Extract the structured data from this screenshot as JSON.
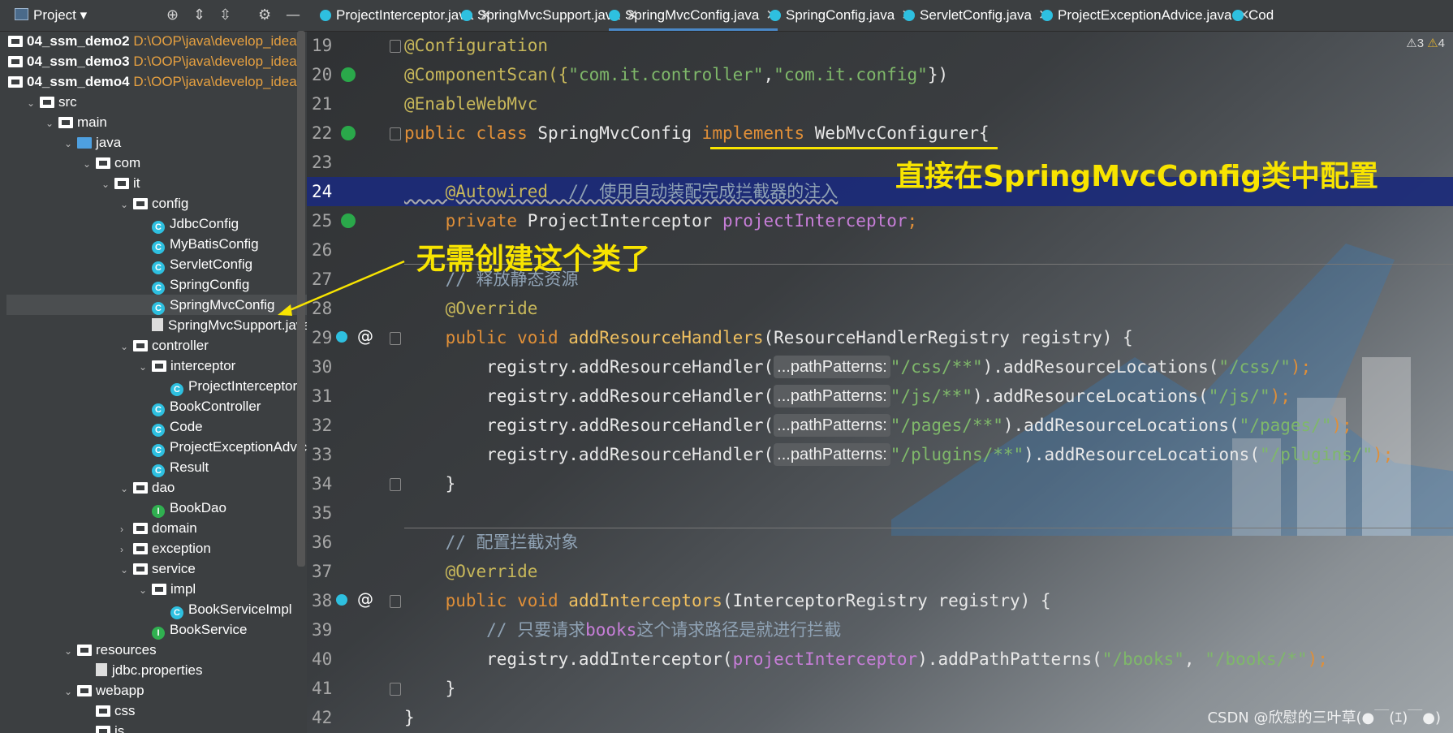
{
  "project_panel": {
    "title": "Project",
    "tree": [
      {
        "label": "04_ssm_demo2",
        "path": "D:\\OOP\\java\\develop_idea",
        "type": "module"
      },
      {
        "label": "04_ssm_demo3",
        "path": "D:\\OOP\\java\\develop_idea",
        "type": "module"
      },
      {
        "label": "04_ssm_demo4",
        "path": "D:\\OOP\\java\\develop_idea",
        "type": "module"
      },
      {
        "label": "src",
        "type": "folder"
      },
      {
        "label": "main",
        "type": "folder"
      },
      {
        "label": "java",
        "type": "folder"
      },
      {
        "label": "com",
        "type": "package"
      },
      {
        "label": "it",
        "type": "package"
      },
      {
        "label": "config",
        "type": "package"
      },
      {
        "label": "JdbcConfig",
        "type": "class"
      },
      {
        "label": "MyBatisConfig",
        "type": "class"
      },
      {
        "label": "ServletConfig",
        "type": "class"
      },
      {
        "label": "SpringConfig",
        "type": "class"
      },
      {
        "label": "SpringMvcConfig",
        "type": "class",
        "selected": true
      },
      {
        "label": "SpringMvcSupport.java",
        "type": "file"
      },
      {
        "label": "controller",
        "type": "package"
      },
      {
        "label": "interceptor",
        "type": "package"
      },
      {
        "label": "ProjectInterceptor",
        "type": "class"
      },
      {
        "label": "BookController",
        "type": "class"
      },
      {
        "label": "Code",
        "type": "class"
      },
      {
        "label": "ProjectExceptionAdvice",
        "type": "class"
      },
      {
        "label": "Result",
        "type": "class"
      },
      {
        "label": "dao",
        "type": "package"
      },
      {
        "label": "BookDao",
        "type": "interface"
      },
      {
        "label": "domain",
        "type": "package"
      },
      {
        "label": "exception",
        "type": "package"
      },
      {
        "label": "service",
        "type": "package"
      },
      {
        "label": "impl",
        "type": "package"
      },
      {
        "label": "BookServiceImpl",
        "type": "class"
      },
      {
        "label": "BookService",
        "type": "interface"
      },
      {
        "label": "resources",
        "type": "folder"
      },
      {
        "label": "jdbc.properties",
        "type": "file"
      },
      {
        "label": "webapp",
        "type": "folder"
      },
      {
        "label": "css",
        "type": "folder"
      },
      {
        "label": "js",
        "type": "folder"
      }
    ]
  },
  "tabs": [
    {
      "label": "ProjectInterceptor.java"
    },
    {
      "label": "SpringMvcSupport.java"
    },
    {
      "label": "SpringMvcConfig.java",
      "active": true
    },
    {
      "label": "SpringConfig.java"
    },
    {
      "label": "ServletConfig.java"
    },
    {
      "label": "ProjectExceptionAdvice.java"
    },
    {
      "label": "Cod"
    }
  ],
  "inspections": {
    "warnings": "3",
    "weak_warnings": "4"
  },
  "line_numbers": [
    "19",
    "20",
    "21",
    "22",
    "23",
    "24",
    "25",
    "26",
    "27",
    "28",
    "29",
    "30",
    "31",
    "32",
    "33",
    "34",
    "35",
    "36",
    "37",
    "38",
    "39",
    "40",
    "41",
    "42"
  ],
  "code": {
    "l19": "@Configuration",
    "l20a": "@ComponentScan({",
    "l20b": "\"com.it.controller\"",
    "l20c": ",",
    "l20d": "\"com.it.config\"",
    "l20e": "})",
    "l21": "@EnableWebMvc",
    "l22a": "public class ",
    "l22b": "SpringMvcConfig ",
    "l22c": "implements ",
    "l22d": "WebMvcConfigurer{",
    "l24a": "    @Autowired",
    "l24b": "  // 使用自动装配完成拦截器的注入",
    "l25a": "    private ",
    "l25b": "ProjectInterceptor ",
    "l25c": "projectInterceptor",
    "l25d": ";",
    "l27": "    // 释放静态资源",
    "l28": "    @Override",
    "l29a": "    public void ",
    "l29b": "addResourceHandlers",
    "l29c": "(ResourceHandlerRegistry registry) {",
    "reg": "        registry.addResourceHandler(",
    "hint": "...pathPatterns:",
    "l30s1": "\"/css/**\"",
    "l30s2": "\"/css/\"",
    "l31s1": "\"/js/**\"",
    "l31s2": "\"/js/\"",
    "l32s1": "\"/pages/**\"",
    "l32s2": "\"/pages/\"",
    "l33s1": "\"/plugins/**\"",
    "l33s2": "\"/plugins/\"",
    "addloc": ").addResourceLocations(",
    "close": ");",
    "l34": "    }",
    "l36": "    // 配置拦截对象",
    "l37": "    @Override",
    "l38a": "    public void ",
    "l38b": "addInterceptors",
    "l38c": "(InterceptorRegistry registry) {",
    "l39a": "        // 只要请求",
    "l39b": "books",
    "l39c": "这个请求路径是就进行拦截",
    "l40a": "        registry.addInterceptor(",
    "l40b": "projectInterceptor",
    "l40c": ").addPathPatterns(",
    "l40d": "\"/books\"",
    "l40e": ", ",
    "l40f": "\"/books/*\"",
    "l40g": ");",
    "l41": "    }",
    "l42": "}"
  },
  "annotations": {
    "note1": "直接在SpringMvcConfig类中配置",
    "note2": "无需创建这个类了",
    "watermark": "CSDN @欣慰的三叶草(●￣(ｴ)￣●)"
  }
}
